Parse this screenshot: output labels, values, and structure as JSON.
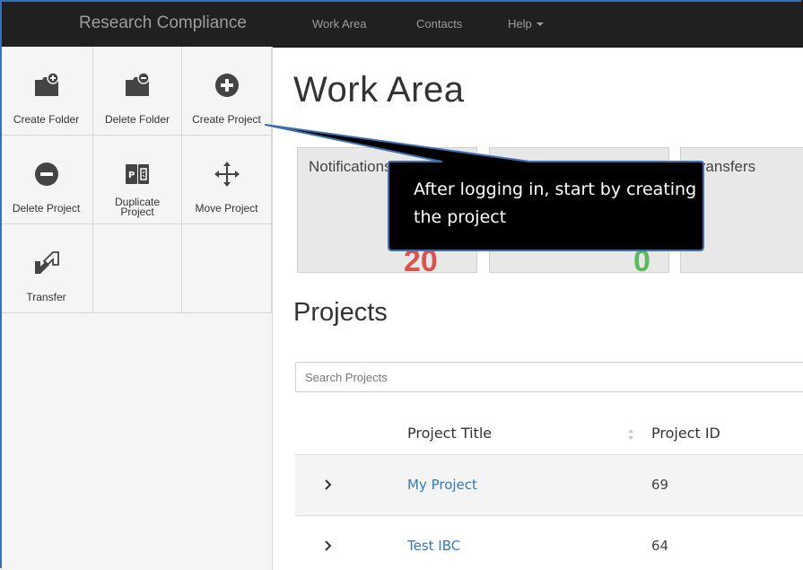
{
  "navbar": {
    "brand": "Research Compliance",
    "links": [
      {
        "label": "Work Area"
      },
      {
        "label": "Contacts"
      },
      {
        "label": "Help"
      }
    ]
  },
  "sidebar": {
    "tools": [
      {
        "label": "Create Folder",
        "icon": "folder-plus-icon"
      },
      {
        "label": "Delete Folder",
        "icon": "folder-minus-icon"
      },
      {
        "label": "Create Project",
        "icon": "plus-circle-icon"
      },
      {
        "label": "Delete Project",
        "icon": "minus-circle-icon"
      },
      {
        "label": "Duplicate Project",
        "icon": "duplicate-icon"
      },
      {
        "label": "Move Project",
        "icon": "move-icon"
      },
      {
        "label": "Transfer",
        "icon": "transfer-icon"
      }
    ]
  },
  "main": {
    "title": "Work Area",
    "tiles": [
      {
        "title": "Notifications",
        "count": "20",
        "color": "#d9534f"
      },
      {
        "title": "",
        "count": "0",
        "color": "#5cb85c"
      },
      {
        "title": "Transfers",
        "count": "",
        "color": "#333333"
      }
    ],
    "projects": {
      "title": "Projects",
      "search_placeholder": "Search Projects",
      "columns": [
        "Project Title",
        "Project ID"
      ],
      "rows": [
        {
          "title": "My Project",
          "id": "69"
        },
        {
          "title": "Test IBC",
          "id": "64"
        }
      ]
    }
  },
  "callout": {
    "text": "After logging in, start by creating the project",
    "background": "#000000",
    "border": "#3e6fb0"
  },
  "colors": {
    "navbar_bg": "#202020",
    "link": "#337ab7",
    "frame": "#3e6fb0"
  }
}
